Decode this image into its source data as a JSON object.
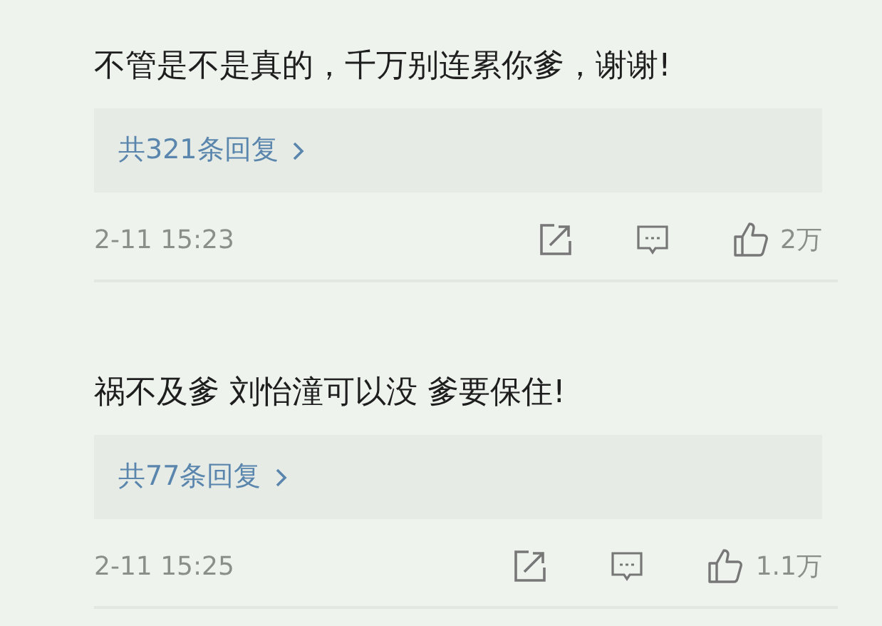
{
  "comments": [
    {
      "text": "不管是不是真的，千万别连累你爹，谢谢!",
      "replies": "共321条回复",
      "time": "2-11 15:23",
      "likes": "2万"
    },
    {
      "text": "祸不及爹 刘怡潼可以没 爹要保住!",
      "replies": "共77条回复",
      "time": "2-11 15:25",
      "likes": "1.1万"
    }
  ]
}
